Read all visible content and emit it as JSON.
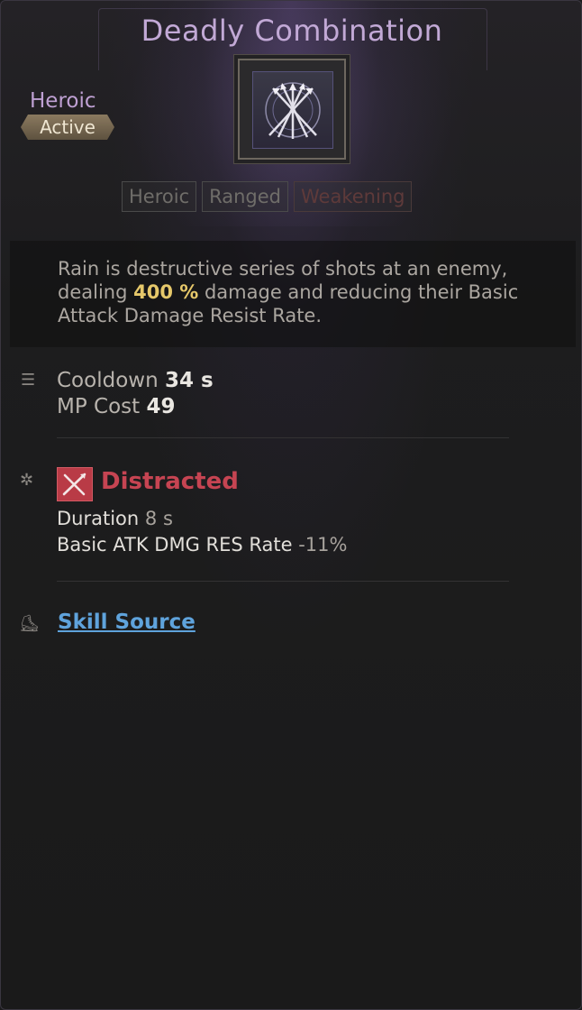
{
  "skill": {
    "title": "Deadly Combination",
    "rarity": "Heroic",
    "type": "Active",
    "icon": "crossed-arrows-icon",
    "tags": [
      "Heroic",
      "Ranged",
      "Weakening"
    ]
  },
  "description": {
    "before": "Rain is destructive series of shots at an enemy, dealing ",
    "highlight": "400 %",
    "after": " damage and reducing their Basic Attack Damage Resist Rate."
  },
  "stats": {
    "cooldown_label": "Cooldown",
    "cooldown_value": "34 s",
    "mp_label": "MP Cost",
    "mp_value": "49"
  },
  "effect": {
    "name": "Distracted",
    "icon": "distracted-effect-icon",
    "duration_label": "Duration",
    "duration_value": "8 s",
    "res_label": "Basic ATK DMG RES Rate",
    "res_value": "-11%"
  },
  "source": {
    "link_label": "Skill Source"
  },
  "colors": {
    "title": "#c2a9d6",
    "highlight": "#e6c86a",
    "effect": "#c64452",
    "link": "#5fa3dc"
  }
}
